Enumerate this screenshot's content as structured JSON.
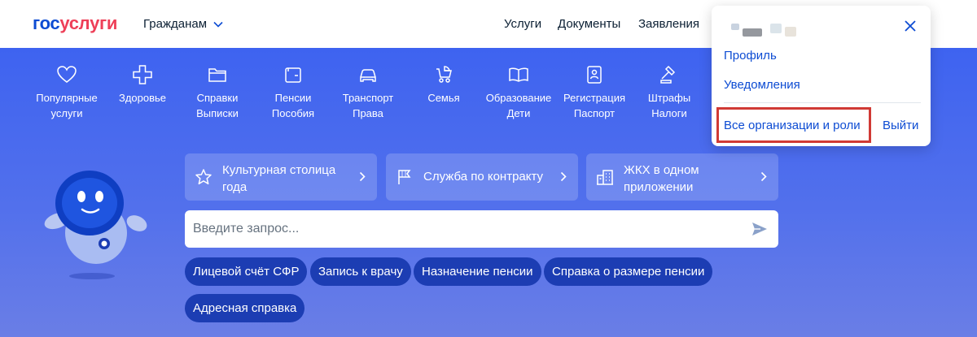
{
  "header": {
    "logo_part1": "гос",
    "logo_part2": "услуги",
    "audience_label": "Гражданам",
    "nav": [
      "Услуги",
      "Документы",
      "Заявления"
    ]
  },
  "categories": [
    {
      "icon": "heart-icon",
      "label": "Популярные услуги"
    },
    {
      "icon": "health-cross-icon",
      "label": "Здоровье"
    },
    {
      "icon": "folder-icon",
      "label": "Справки Выписки"
    },
    {
      "icon": "wallet-icon",
      "label": "Пенсии Пособия"
    },
    {
      "icon": "car-icon",
      "label": "Транспорт Права"
    },
    {
      "icon": "stroller-icon",
      "label": "Семья"
    },
    {
      "icon": "book-icon",
      "label": "Образование Дети"
    },
    {
      "icon": "passport-icon",
      "label": "Регистрация Паспорт"
    },
    {
      "icon": "gavel-icon",
      "label": "Штрафы Налоги"
    }
  ],
  "promos": [
    {
      "icon": "star-icon",
      "label": "Культурная столица года"
    },
    {
      "icon": "flag-icon",
      "label": "Служба по контракту"
    },
    {
      "icon": "buildings-icon",
      "label": "ЖКХ в одном приложении"
    }
  ],
  "search": {
    "placeholder": "Введите запрос..."
  },
  "chips": [
    "Лицевой счёт СФР",
    "Запись к врачу",
    "Назначение пенсии",
    "Справка о размере пенсии",
    "Адресная справка"
  ],
  "dropdown": {
    "items": [
      "Профиль",
      "Уведомления"
    ],
    "organizations": "Все организации и роли",
    "logout": "Выйти"
  },
  "colors": {
    "brand_blue": "#0d4cd3",
    "brand_red": "#ee3f58",
    "hero_blue": "#4a6cf0",
    "chip": "#1c3db3",
    "highlight": "#d03a35"
  }
}
